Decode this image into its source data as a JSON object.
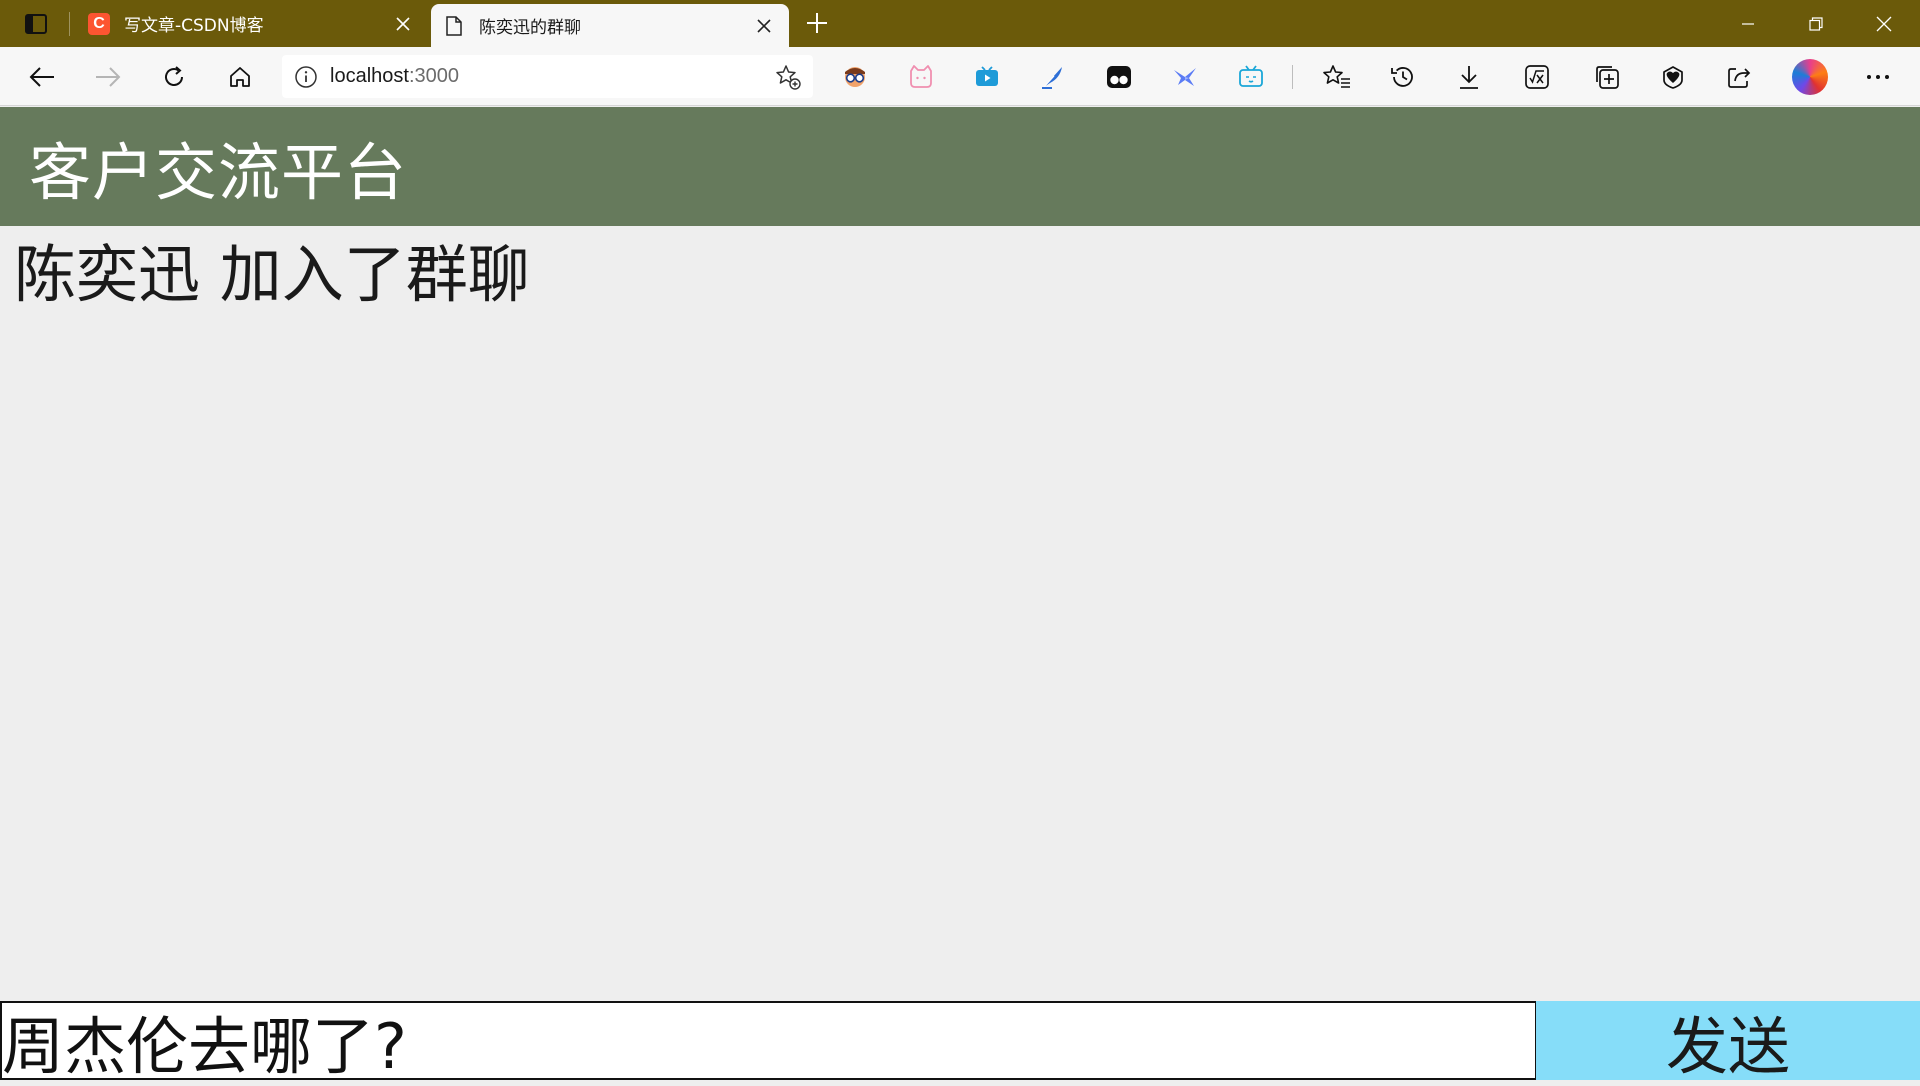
{
  "browser": {
    "tabs": [
      {
        "title": "写文章-CSDN博客",
        "favicon": "csdn-icon",
        "favicon_letter": "C",
        "active": false
      },
      {
        "title": "陈奕迅的群聊",
        "favicon": "page-icon",
        "active": true
      }
    ],
    "address": {
      "host": "localhost",
      "port": ":3000"
    },
    "colors": {
      "tabstrip": "#6b5a0a",
      "toolbar": "#f7f7f7"
    }
  },
  "app": {
    "title": "客户交流平台",
    "header_color": "#667a5c",
    "messages": [
      {
        "text": "陈奕迅 加入了群聊"
      }
    ],
    "composer": {
      "input_value": "周杰伦去哪了?",
      "send_label": "发送",
      "send_color": "#86ddf9"
    }
  }
}
